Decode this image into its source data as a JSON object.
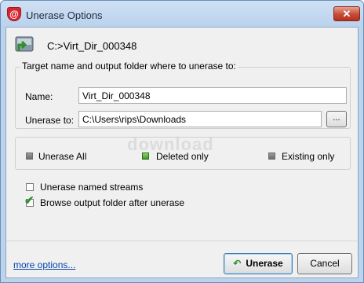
{
  "window": {
    "title": "Unerase Options",
    "app_icon_glyph": "@",
    "close_glyph": "✕"
  },
  "header": {
    "icon": "drive-restore-icon",
    "path": "C:>Virt_Dir_000348"
  },
  "target_group": {
    "label": "Target name and output folder where to unerase to:",
    "name_label": "Name:",
    "name_value": "Virt_Dir_000348",
    "folder_label": "Unerase to:",
    "folder_value": "C:\\Users\\rips\\Downloads",
    "browse_label": "..."
  },
  "watermark": "download",
  "modes": [
    {
      "label": "Unerase All",
      "selected": false
    },
    {
      "label": "Deleted only",
      "selected": true
    },
    {
      "label": "Existing only",
      "selected": false
    }
  ],
  "options": [
    {
      "label": "Unerase named streams",
      "checked": false
    },
    {
      "label": "Browse output folder after unerase",
      "checked": true
    }
  ],
  "footer": {
    "more_link": "more options...",
    "unerase_label": "Unerase",
    "cancel_label": "Cancel"
  },
  "colors": {
    "accent_green": "#3f9a2a",
    "close_red": "#c74a36",
    "link_blue": "#0645ad"
  }
}
